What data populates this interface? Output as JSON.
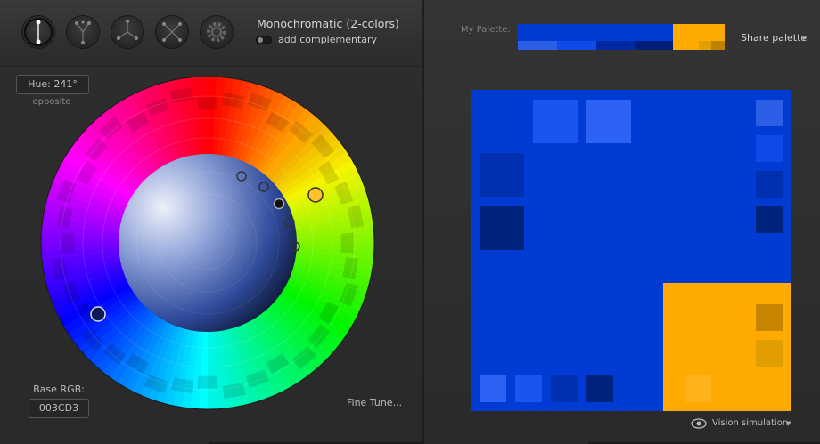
{
  "header": {
    "scheme_title": "Monochromatic (2-colors)",
    "complementary_label": "add complementary",
    "toolbar_icons": [
      "mono-icon",
      "complement-icon",
      "triad-icon",
      "tetrad-icon",
      "gear-icon"
    ]
  },
  "wheel": {
    "hue_label": "Hue: 241°",
    "mode_label": "opposite",
    "base_label": "Base RGB:",
    "base_value": "003CD3",
    "fine_tune": "Fine Tune..."
  },
  "palette": {
    "label": "My Palette:",
    "share": "Share palette",
    "main_colors": [
      "#003CD3",
      "#FFAA00"
    ],
    "primary_shades": [
      "#2D5EE6",
      "#0F4BE8",
      "#0028A0",
      "#001D7A"
    ],
    "secondary_shades": [
      "#E0A000",
      "#C08000"
    ]
  },
  "preview": {
    "background": "#003CD3",
    "accent": "#FFAA00"
  },
  "footer": {
    "vision": "Vision simulation"
  }
}
